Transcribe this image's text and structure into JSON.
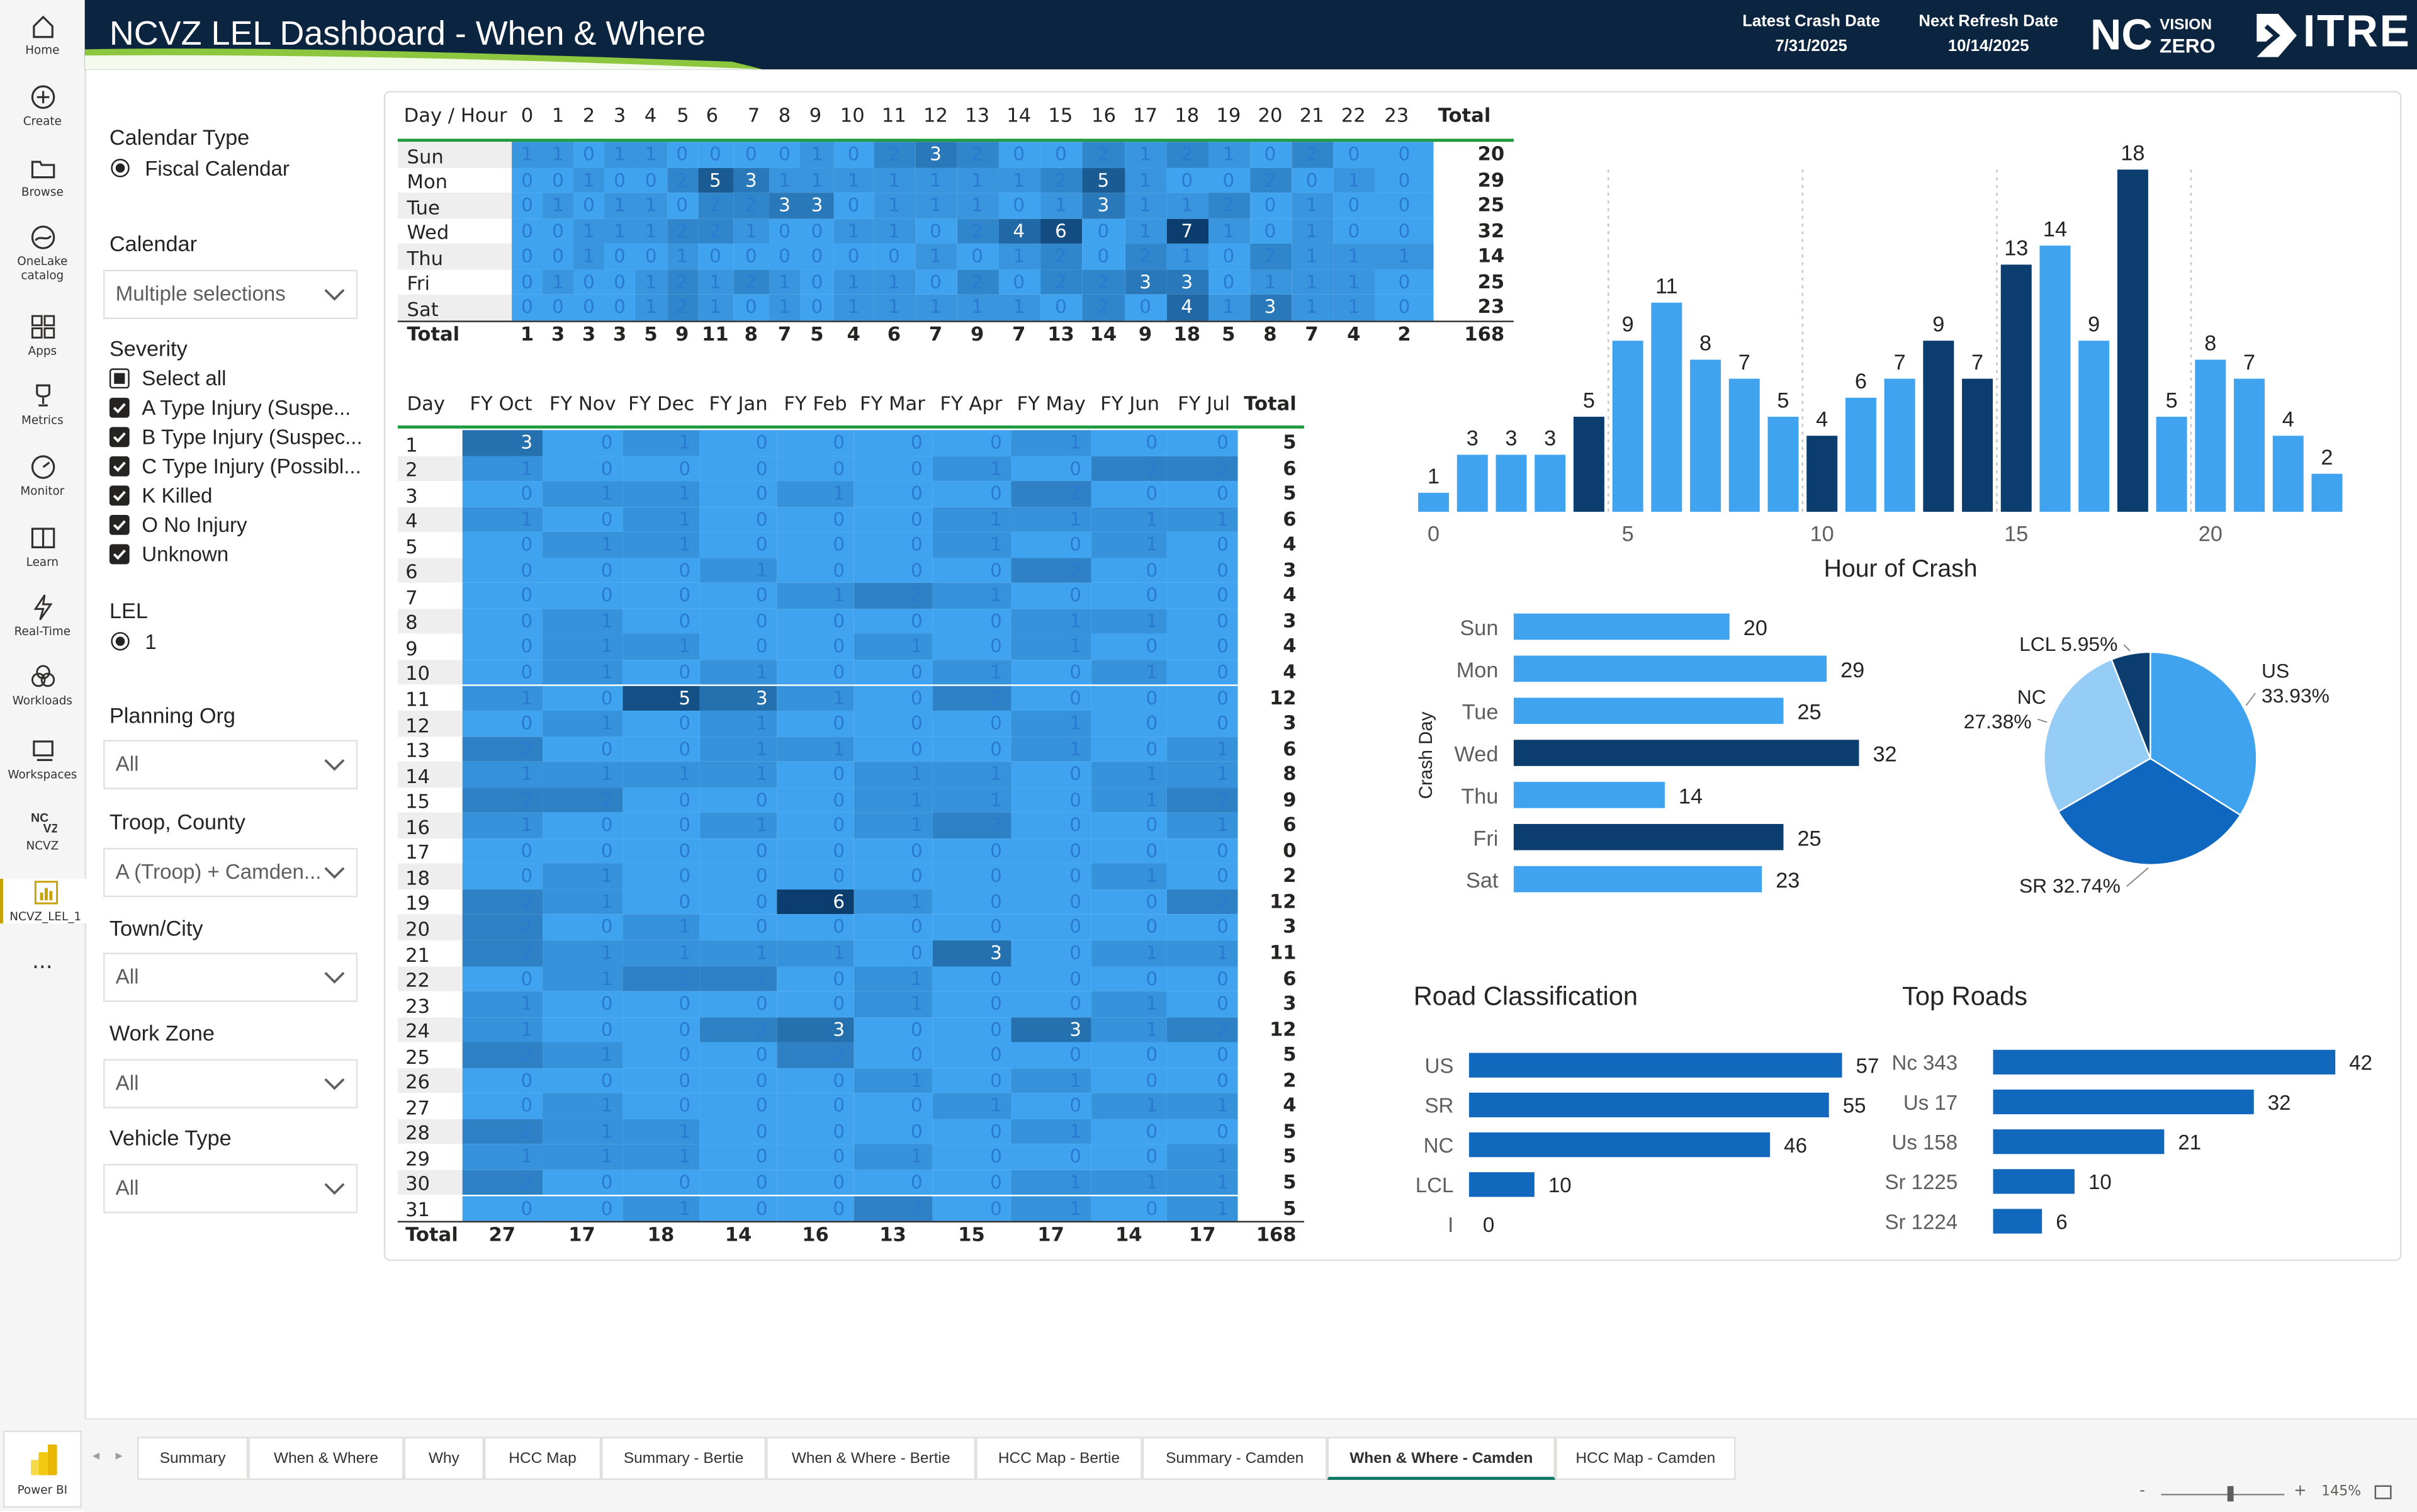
{
  "app": {
    "product_label": "Power BI"
  },
  "nav": [
    {
      "label": "Home",
      "icon": "home-icon"
    },
    {
      "label": "Create",
      "icon": "plus-icon"
    },
    {
      "label": "Browse",
      "icon": "folder-icon"
    },
    {
      "label": "OneLake catalog",
      "icon": "onelake-icon"
    },
    {
      "label": "Apps",
      "icon": "apps-icon"
    },
    {
      "label": "Metrics",
      "icon": "trophy-icon"
    },
    {
      "label": "Monitor",
      "icon": "monitor-icon"
    },
    {
      "label": "Learn",
      "icon": "book-icon"
    },
    {
      "label": "Real-Time",
      "icon": "lightning-icon"
    },
    {
      "label": "Workloads",
      "icon": "workloads-icon"
    },
    {
      "label": "Workspaces",
      "icon": "workspaces-icon"
    },
    {
      "label": "NCVZ",
      "icon": "ncvz-icon"
    },
    {
      "label": "NCVZ_LEL_1",
      "icon": "report-icon"
    }
  ],
  "header": {
    "title": "NCVZ LEL Dashboard - When & Where",
    "latest_label": "Latest Crash Date",
    "latest_value": "7/31/2025",
    "refresh_label": "Next Refresh Date",
    "refresh_value": "10/14/2025",
    "logo_nc": "NC",
    "logo_vision": "VISION",
    "logo_zero": "ZERO",
    "logo_itre": "ITRE",
    "colors": {
      "header_bg": "#0b2540",
      "accent_green": "#8dc63f"
    }
  },
  "filters": {
    "calendar_type": {
      "title": "Calendar Type",
      "option": "Fiscal Calendar"
    },
    "calendar": {
      "title": "Calendar",
      "value": "Multiple selections"
    },
    "severity": {
      "title": "Severity",
      "options": [
        {
          "label": "Select all",
          "checked": false
        },
        {
          "label": "A Type Injury (Suspe...",
          "checked": true
        },
        {
          "label": "B Type Injury (Suspec...",
          "checked": true
        },
        {
          "label": "C Type Injury (Possibl...",
          "checked": true
        },
        {
          "label": "K Killed",
          "checked": true
        },
        {
          "label": "O No Injury",
          "checked": true
        },
        {
          "label": "Unknown",
          "checked": true
        }
      ]
    },
    "lel": {
      "title": "LEL",
      "option": "1"
    },
    "planning_org": {
      "title": "Planning Org",
      "value": "All"
    },
    "troop_county": {
      "title": "Troop, County",
      "value": "A (Troop) + Camden..."
    },
    "town_city": {
      "title": "Town/City",
      "value": "All"
    },
    "work_zone": {
      "title": "Work Zone",
      "value": "All"
    },
    "vehicle_type": {
      "title": "Vehicle Type",
      "value": "All"
    }
  },
  "hour_matrix": {
    "corner": "Day / Hour",
    "columns": [
      "0",
      "1",
      "2",
      "3",
      "4",
      "5",
      "6",
      "7",
      "8",
      "9",
      "10",
      "11",
      "12",
      "13",
      "14",
      "15",
      "16",
      "17",
      "18",
      "19",
      "20",
      "21",
      "22",
      "23"
    ],
    "total_label": "Total",
    "rows": [
      {
        "label": "Sun",
        "values": [
          1,
          1,
          0,
          1,
          1,
          0,
          0,
          0,
          0,
          1,
          0,
          2,
          3,
          2,
          0,
          0,
          2,
          1,
          2,
          1,
          0,
          2,
          0,
          0
        ],
        "total": 20
      },
      {
        "label": "Mon",
        "values": [
          0,
          0,
          1,
          0,
          0,
          2,
          5,
          3,
          1,
          1,
          1,
          1,
          1,
          1,
          1,
          2,
          5,
          1,
          0,
          0,
          2,
          0,
          1,
          0
        ],
        "total": 29
      },
      {
        "label": "Tue",
        "values": [
          0,
          1,
          0,
          1,
          1,
          0,
          2,
          2,
          3,
          3,
          0,
          1,
          1,
          1,
          0,
          1,
          3,
          1,
          1,
          2,
          0,
          1,
          0,
          0
        ],
        "total": 25
      },
      {
        "label": "Wed",
        "values": [
          0,
          0,
          1,
          1,
          1,
          2,
          2,
          1,
          0,
          0,
          1,
          1,
          0,
          2,
          4,
          6,
          0,
          1,
          7,
          1,
          0,
          1,
          0,
          0
        ],
        "total": 32
      },
      {
        "label": "Thu",
        "values": [
          0,
          0,
          1,
          0,
          0,
          1,
          0,
          0,
          0,
          0,
          0,
          0,
          1,
          0,
          1,
          2,
          0,
          2,
          1,
          0,
          2,
          1,
          1,
          1
        ],
        "total": 14
      },
      {
        "label": "Fri",
        "values": [
          0,
          1,
          0,
          0,
          1,
          2,
          1,
          2,
          1,
          0,
          1,
          1,
          0,
          2,
          0,
          2,
          2,
          3,
          3,
          0,
          1,
          1,
          1,
          0
        ],
        "total": 25
      },
      {
        "label": "Sat",
        "values": [
          0,
          0,
          0,
          0,
          1,
          2,
          1,
          0,
          1,
          0,
          1,
          1,
          1,
          1,
          1,
          0,
          2,
          0,
          4,
          1,
          3,
          1,
          1,
          0
        ],
        "total": 23
      }
    ],
    "footer_label": "Total",
    "col_totals": [
      1,
      3,
      3,
      3,
      5,
      9,
      11,
      8,
      7,
      5,
      4,
      6,
      7,
      9,
      7,
      13,
      14,
      9,
      18,
      5,
      8,
      7,
      4,
      2
    ],
    "grand_total": 168
  },
  "month_matrix": {
    "corner": "Day",
    "columns": [
      "FY Oct",
      "FY Nov",
      "FY Dec",
      "FY Jan",
      "FY Feb",
      "FY Mar",
      "FY Apr",
      "FY May",
      "FY Jun",
      "FY Jul"
    ],
    "total_label": "Total",
    "rows": [
      {
        "label": "1",
        "values": [
          3,
          0,
          1,
          0,
          0,
          0,
          0,
          1,
          0,
          0
        ],
        "total": 5
      },
      {
        "label": "2",
        "values": [
          1,
          0,
          0,
          0,
          0,
          0,
          1,
          0,
          2,
          2
        ],
        "total": 6
      },
      {
        "label": "3",
        "values": [
          0,
          1,
          1,
          0,
          1,
          0,
          0,
          2,
          0,
          0
        ],
        "total": 5
      },
      {
        "label": "4",
        "values": [
          1,
          0,
          1,
          0,
          0,
          0,
          1,
          1,
          1,
          1
        ],
        "total": 6
      },
      {
        "label": "5",
        "values": [
          0,
          1,
          1,
          0,
          0,
          0,
          1,
          0,
          1,
          0
        ],
        "total": 4
      },
      {
        "label": "6",
        "values": [
          0,
          0,
          0,
          1,
          0,
          0,
          0,
          2,
          0,
          0
        ],
        "total": 3
      },
      {
        "label": "7",
        "values": [
          0,
          0,
          0,
          0,
          1,
          2,
          1,
          0,
          0,
          0
        ],
        "total": 4
      },
      {
        "label": "8",
        "values": [
          0,
          1,
          0,
          0,
          0,
          0,
          0,
          1,
          1,
          0
        ],
        "total": 3
      },
      {
        "label": "9",
        "values": [
          0,
          1,
          1,
          0,
          0,
          1,
          0,
          1,
          0,
          0
        ],
        "total": 4
      },
      {
        "label": "10",
        "values": [
          0,
          1,
          0,
          1,
          0,
          0,
          1,
          0,
          1,
          0
        ],
        "total": 4
      },
      {
        "label": "11",
        "values": [
          1,
          0,
          5,
          3,
          1,
          0,
          2,
          0,
          0,
          0
        ],
        "total": 12
      },
      {
        "label": "12",
        "values": [
          0,
          1,
          0,
          1,
          0,
          0,
          0,
          1,
          0,
          0
        ],
        "total": 3
      },
      {
        "label": "13",
        "values": [
          2,
          0,
          0,
          1,
          1,
          0,
          0,
          1,
          0,
          1
        ],
        "total": 6
      },
      {
        "label": "14",
        "values": [
          1,
          1,
          1,
          1,
          0,
          1,
          1,
          0,
          1,
          1
        ],
        "total": 8
      },
      {
        "label": "15",
        "values": [
          2,
          2,
          0,
          0,
          0,
          1,
          1,
          0,
          1,
          2
        ],
        "total": 9
      },
      {
        "label": "16",
        "values": [
          1,
          0,
          0,
          1,
          0,
          1,
          2,
          0,
          0,
          1
        ],
        "total": 6
      },
      {
        "label": "17",
        "values": [
          0,
          0,
          0,
          0,
          0,
          0,
          0,
          0,
          0,
          0
        ],
        "total": 0
      },
      {
        "label": "18",
        "values": [
          0,
          1,
          0,
          0,
          0,
          0,
          0,
          0,
          1,
          0
        ],
        "total": 2
      },
      {
        "label": "19",
        "values": [
          2,
          1,
          0,
          0,
          6,
          1,
          0,
          0,
          0,
          2
        ],
        "total": 12
      },
      {
        "label": "20",
        "values": [
          2,
          0,
          1,
          0,
          0,
          0,
          0,
          0,
          0,
          0
        ],
        "total": 3
      },
      {
        "label": "21",
        "values": [
          2,
          1,
          1,
          1,
          1,
          0,
          3,
          0,
          1,
          1
        ],
        "total": 11
      },
      {
        "label": "22",
        "values": [
          0,
          1,
          2,
          2,
          0,
          1,
          0,
          0,
          0,
          0
        ],
        "total": 6
      },
      {
        "label": "23",
        "values": [
          1,
          0,
          0,
          0,
          0,
          1,
          0,
          0,
          1,
          0
        ],
        "total": 3
      },
      {
        "label": "24",
        "values": [
          1,
          0,
          0,
          2,
          3,
          0,
          0,
          3,
          1,
          2
        ],
        "total": 12
      },
      {
        "label": "25",
        "values": [
          2,
          1,
          0,
          0,
          2,
          0,
          0,
          0,
          0,
          0
        ],
        "total": 5
      },
      {
        "label": "26",
        "values": [
          0,
          0,
          0,
          0,
          0,
          1,
          0,
          1,
          0,
          0
        ],
        "total": 2
      },
      {
        "label": "27",
        "values": [
          0,
          1,
          0,
          0,
          0,
          0,
          1,
          0,
          1,
          1
        ],
        "total": 4
      },
      {
        "label": "28",
        "values": [
          2,
          1,
          1,
          0,
          0,
          0,
          0,
          1,
          0,
          0
        ],
        "total": 5
      },
      {
        "label": "29",
        "values": [
          1,
          1,
          1,
          0,
          0,
          1,
          0,
          0,
          0,
          1
        ],
        "total": 5
      },
      {
        "label": "30",
        "values": [
          2,
          0,
          0,
          0,
          0,
          0,
          0,
          1,
          1,
          1
        ],
        "total": 5
      },
      {
        "label": "31",
        "values": [
          0,
          0,
          1,
          0,
          0,
          2,
          0,
          1,
          0,
          1
        ],
        "total": 5
      }
    ],
    "footer_label": "Total",
    "col_totals": [
      27,
      17,
      18,
      14,
      16,
      13,
      15,
      17,
      14,
      17
    ],
    "grand_total": 168
  },
  "chart_data": [
    {
      "type": "bar",
      "x": [
        0,
        1,
        2,
        3,
        4,
        5,
        6,
        7,
        8,
        9,
        10,
        11,
        12,
        13,
        14,
        15,
        16,
        17,
        18,
        19,
        20,
        21,
        22,
        23
      ],
      "values": [
        1,
        3,
        3,
        3,
        5,
        9,
        11,
        8,
        7,
        5,
        4,
        6,
        7,
        9,
        7,
        13,
        14,
        9,
        18,
        5,
        8,
        7,
        4,
        2
      ],
      "highlight_hours": [
        4,
        10,
        13,
        14,
        15,
        18
      ],
      "xlabel": "Hour of Crash",
      "xticks": [
        "0",
        "5",
        "10",
        "15",
        "20"
      ],
      "colors": {
        "bar": "#3fa3f0",
        "highlight": "#0b3e6f"
      }
    },
    {
      "type": "bar",
      "orientation": "horizontal",
      "categories": [
        "Sun",
        "Mon",
        "Tue",
        "Wed",
        "Thu",
        "Fri",
        "Sat"
      ],
      "values": [
        20,
        29,
        25,
        32,
        14,
        25,
        23
      ],
      "highlight": [
        "Wed",
        "Fri"
      ],
      "ylabel": "Crash Day",
      "colors": {
        "bar": "#3fa3f0",
        "highlight": "#0b3e6f"
      }
    },
    {
      "type": "pie",
      "slices": [
        {
          "name": "US",
          "label": "US",
          "pct_label": "33.93%",
          "value": 33.93,
          "color": "#3fa3f0"
        },
        {
          "name": "SR",
          "label": "SR 32.74%",
          "value": 32.74,
          "color": "#1067c0"
        },
        {
          "name": "NC",
          "label": "NC",
          "pct_label": "27.38%",
          "value": 27.38,
          "color": "#96cdf7"
        },
        {
          "name": "LCL",
          "label": "LCL 5.95%",
          "value": 5.95,
          "color": "#0b3e6f"
        }
      ]
    },
    {
      "type": "bar",
      "orientation": "horizontal",
      "title": "Road Classification",
      "categories": [
        "US",
        "SR",
        "NC",
        "LCL",
        "I"
      ],
      "values": [
        57,
        55,
        46,
        10,
        0
      ],
      "colors": {
        "bar": "#1268bd"
      }
    },
    {
      "type": "bar",
      "orientation": "horizontal",
      "title": "Top Roads",
      "categories": [
        "Nc 343",
        "Us 17",
        "Us 158",
        "Sr 1225",
        "Sr 1224"
      ],
      "values": [
        42,
        32,
        21,
        10,
        6
      ],
      "colors": {
        "bar": "#1268bd"
      }
    }
  ],
  "tabs": [
    {
      "label": "Summary",
      "active": false
    },
    {
      "label": "When & Where",
      "active": false
    },
    {
      "label": "Why",
      "active": false
    },
    {
      "label": "HCC Map",
      "active": false
    },
    {
      "label": "Summary - Bertie",
      "active": false
    },
    {
      "label": "When & Where - Bertie",
      "active": false
    },
    {
      "label": "HCC Map - Bertie",
      "active": false
    },
    {
      "label": "Summary - Camden",
      "active": false
    },
    {
      "label": "When & Where - Camden",
      "active": true
    },
    {
      "label": "HCC Map - Camden",
      "active": false
    }
  ],
  "zoom": {
    "minus": "-",
    "plus": "+",
    "value": "145%"
  }
}
